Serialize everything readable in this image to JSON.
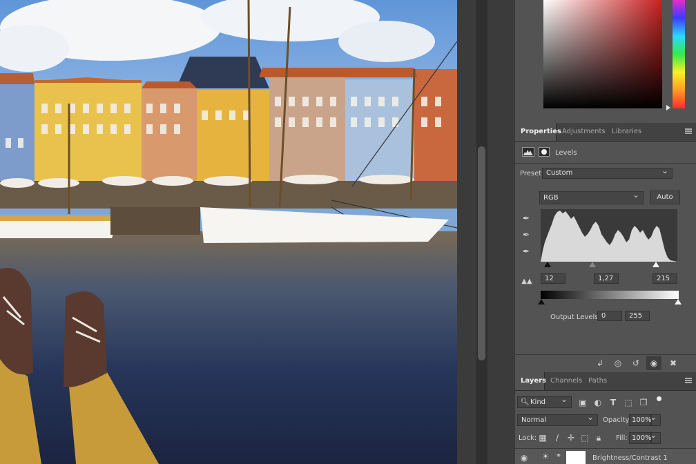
{
  "properties_panel": {
    "tabs": [
      "Properties",
      "Adjustments",
      "Libraries"
    ],
    "adjustment_title": "Levels",
    "preset_label": "Preset:",
    "preset_value": "Custom",
    "channel_value": "RGB",
    "auto_label": "Auto",
    "input_levels": [
      "12",
      "1,27",
      "215"
    ],
    "output_label": "Output Levels:",
    "output_levels": [
      "0",
      "255"
    ]
  },
  "layers_panel": {
    "tabs": [
      "Layers",
      "Channels",
      "Paths"
    ],
    "filter_kind": "Kind",
    "blend_mode": "Normal",
    "opacity_label": "Opacity:",
    "opacity_value": "100%",
    "lock_label": "Lock:",
    "fill_label": "Fill:",
    "fill_value": "100%",
    "layer_name": "Brightness/Contrast 1"
  },
  "icons": {
    "eyedroppers": [
      "black-point-eyedropper-icon",
      "gray-point-eyedropper-icon",
      "white-point-eyedropper-icon"
    ],
    "footer": [
      "clip-to-layer-icon",
      "view-previous-state-icon",
      "reset-icon",
      "visibility-icon",
      "delete-icon"
    ]
  },
  "colors": {
    "panel_bg": "#535353",
    "tab_bg": "#424242",
    "canvas_gutter": "#3b3b3b"
  }
}
